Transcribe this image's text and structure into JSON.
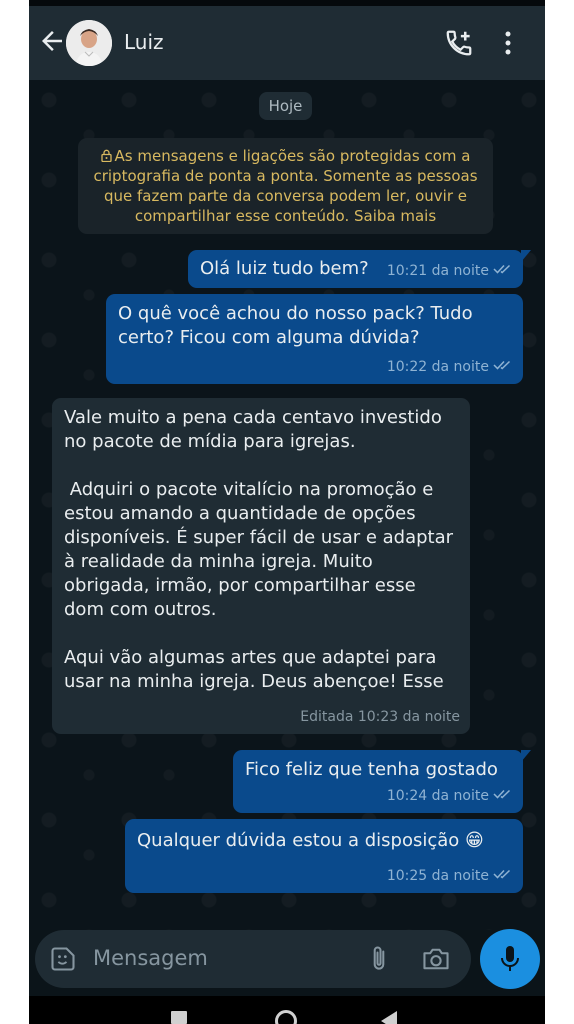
{
  "header": {
    "contact_name": "Luiz"
  },
  "chat": {
    "date_chip": "Hoje",
    "encryption_notice": "As mensagens e ligações são protegidas com a criptografia de ponta a ponta. Somente as pessoas que fazem parte da conversa podem ler, ouvir e compartilhar esse conteúdo. Saiba mais",
    "messages": [
      {
        "direction": "out",
        "text": "Olá luiz tudo bem?",
        "time": "10:21 da noite",
        "status": "read"
      },
      {
        "direction": "out",
        "text": "O quê você achou do nosso pack? Tudo certo? Ficou com alguma dúvida?",
        "time": "10:22 da noite",
        "status": "read"
      },
      {
        "direction": "in",
        "text": "Vale muito a pena cada centavo investido no pacote de mídia para igrejas.\n\n Adquiri o pacote vitalício na promoção e estou amando a quantidade de opções disponíveis. É super fácil de usar e adaptar à realidade da minha igreja. Muito obrigada, irmão, por compartilhar esse dom com outros.\n\nAqui vão algumas artes que adaptei para usar na minha igreja. Deus abençoe! Esse",
        "time": "Editada 10:23 da noite"
      },
      {
        "direction": "out",
        "text": "Fico feliz que tenha gostado",
        "time": "10:24 da noite",
        "status": "read"
      },
      {
        "direction": "out",
        "text": "Qualquer dúvida estou a disposição 😁",
        "time": "10:25 da noite",
        "status": "read"
      }
    ]
  },
  "composer": {
    "placeholder": "Mensagem"
  },
  "colors": {
    "header_bg": "#1f2c34",
    "outgoing_bubble": "#0a4a8c",
    "incoming_bubble": "#1f2c34",
    "notice_text": "#d8b960",
    "mic_button": "#1b8fe0"
  },
  "icons": [
    "back-arrow-icon",
    "avatar",
    "add-call-icon",
    "more-vert-icon",
    "lock-icon",
    "read-ticks-icon",
    "emoji-sticker-icon",
    "attach-icon",
    "camera-icon",
    "mic-icon"
  ]
}
